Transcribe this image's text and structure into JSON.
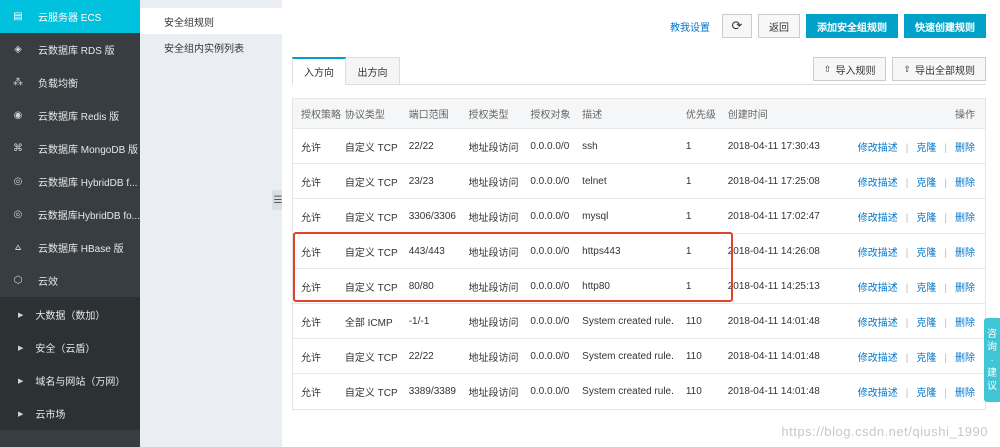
{
  "sidebar": {
    "products": [
      {
        "label": "云服务器 ECS",
        "icon": "server-icon",
        "active": true
      },
      {
        "label": "云数据库 RDS 版",
        "icon": "database-icon"
      },
      {
        "label": "负载均衡",
        "icon": "load-balancer-icon"
      },
      {
        "label": "云数据库 Redis 版",
        "icon": "redis-icon"
      },
      {
        "label": "云数据库 MongoDB 版",
        "icon": "mongodb-icon"
      },
      {
        "label": "云数据库 HybridDB f...",
        "icon": "hybriddb-icon"
      },
      {
        "label": "云数据库HybridDB fo...",
        "icon": "hybriddb-icon"
      },
      {
        "label": "云数据库 HBase 版",
        "icon": "hbase-icon"
      },
      {
        "label": "云效",
        "icon": "devops-icon"
      }
    ],
    "groups": [
      {
        "label": "大数据（数加）"
      },
      {
        "label": "安全（云盾）"
      },
      {
        "label": "域名与网站（万网）"
      },
      {
        "label": "云市场"
      }
    ]
  },
  "subnav": {
    "items": [
      {
        "label": "安全组规则",
        "active": true
      },
      {
        "label": "安全组内实例列表"
      }
    ],
    "collapse_glyph": "☰"
  },
  "toolbar": {
    "tutorial_label": "教我设置",
    "refresh_glyph": "⟳",
    "back_label": "返回",
    "add_rule_label": "添加安全组规则",
    "quick_rule_label": "快速创建规则"
  },
  "tabs": {
    "inbound_label": "入方向",
    "outbound_label": "出方向",
    "import_label": "导入规则",
    "export_label": "导出全部规则",
    "import_glyph": "⇧",
    "export_glyph": "⇧"
  },
  "table": {
    "columns": [
      "授权策略",
      "协议类型",
      "端口范围",
      "授权类型",
      "授权对象",
      "描述",
      "优先级",
      "创建时间",
      "操作"
    ],
    "rows": [
      {
        "policy": "允许",
        "protocol": "自定义 TCP",
        "port": "22/22",
        "auth_type": "地址段访问",
        "target": "0.0.0.0/0",
        "desc": "ssh",
        "priority": "1",
        "created": "2018-04-11 17:30:43"
      },
      {
        "policy": "允许",
        "protocol": "自定义 TCP",
        "port": "23/23",
        "auth_type": "地址段访问",
        "target": "0.0.0.0/0",
        "desc": "telnet",
        "priority": "1",
        "created": "2018-04-11 17:25:08"
      },
      {
        "policy": "允许",
        "protocol": "自定义 TCP",
        "port": "3306/3306",
        "auth_type": "地址段访问",
        "target": "0.0.0.0/0",
        "desc": "mysql",
        "priority": "1",
        "created": "2018-04-11 17:02:47"
      },
      {
        "policy": "允许",
        "protocol": "自定义 TCP",
        "port": "443/443",
        "auth_type": "地址段访问",
        "target": "0.0.0.0/0",
        "desc": "https443",
        "priority": "1",
        "created": "2018-04-11 14:26:08"
      },
      {
        "policy": "允许",
        "protocol": "自定义 TCP",
        "port": "80/80",
        "auth_type": "地址段访问",
        "target": "0.0.0.0/0",
        "desc": "http80",
        "priority": "1",
        "created": "2018-04-11 14:25:13"
      },
      {
        "policy": "允许",
        "protocol": "全部 ICMP",
        "port": "-1/-1",
        "auth_type": "地址段访问",
        "target": "0.0.0.0/0",
        "desc": "System created rule.",
        "priority": "110",
        "created": "2018-04-11 14:01:48"
      },
      {
        "policy": "允许",
        "protocol": "自定义 TCP",
        "port": "22/22",
        "auth_type": "地址段访问",
        "target": "0.0.0.0/0",
        "desc": "System created rule.",
        "priority": "110",
        "created": "2018-04-11 14:01:48"
      },
      {
        "policy": "允许",
        "protocol": "自定义 TCP",
        "port": "3389/3389",
        "auth_type": "地址段访问",
        "target": "0.0.0.0/0",
        "desc": "System created rule.",
        "priority": "110",
        "created": "2018-04-11 14:01:48"
      }
    ],
    "op_edit": "修改描述",
    "op_clone": "克隆",
    "op_delete": "删除",
    "op_sep": "|"
  },
  "float_tab": {
    "label": [
      "咨",
      "询",
      "·",
      "建",
      "议"
    ]
  },
  "watermark": "https://blog.csdn.net/qiushi_1990",
  "colors": {
    "sidebar_bg": "#373d41",
    "active_cyan": "#00c1de",
    "primary_button": "#00a2ca",
    "link": "#0077cc",
    "highlight_border": "#e0422a"
  }
}
